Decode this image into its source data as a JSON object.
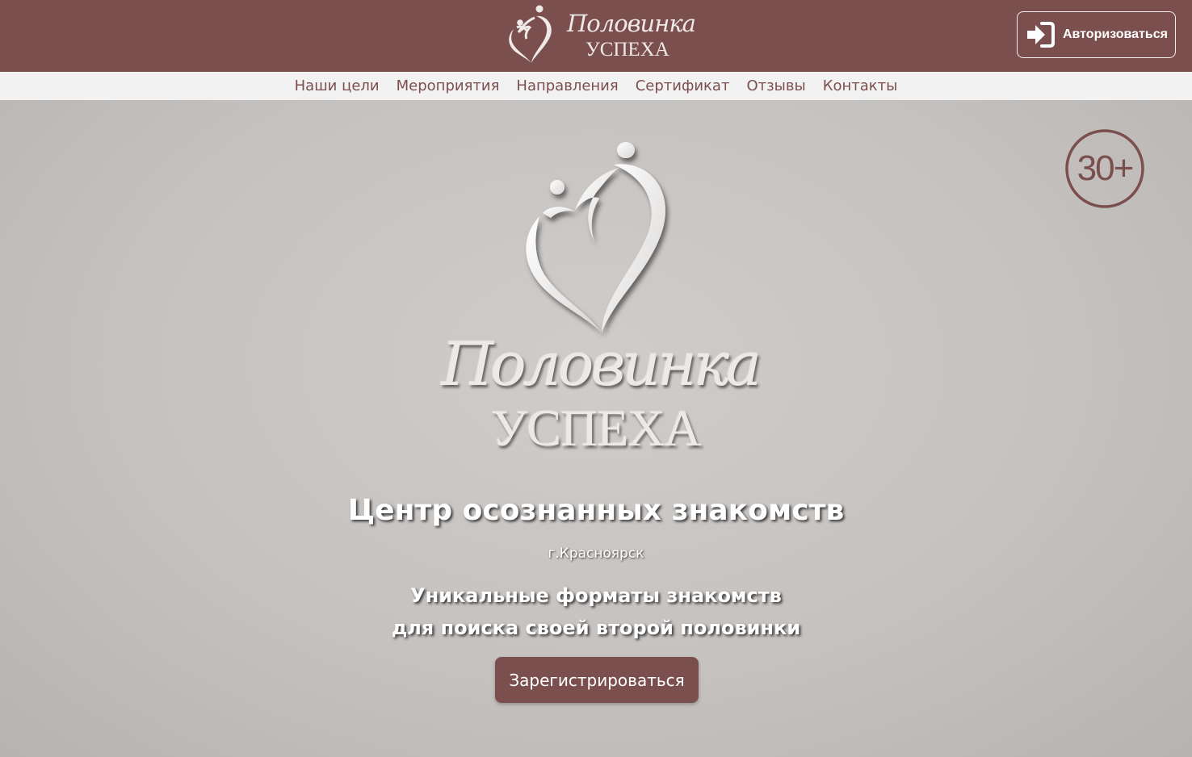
{
  "brand": {
    "script_name": "Половинка",
    "caps_name": "УСПЕХА"
  },
  "header": {
    "login_label": "Авторизоваться",
    "login_icon": "sign-in-icon"
  },
  "nav": {
    "items": [
      {
        "label": "Наши цели"
      },
      {
        "label": "Мероприятия"
      },
      {
        "label": "Направления"
      },
      {
        "label": "Сертификат"
      },
      {
        "label": "Отзывы"
      },
      {
        "label": "Контакты"
      }
    ]
  },
  "hero": {
    "age_badge": "30+",
    "title": "Центр осознанных знакомств",
    "city": "г.Красноярск",
    "subtitle_line1": "Уникальные форматы знакомств",
    "subtitle_line2": "для поиска своей второй половинки",
    "register_label": "Зарегистрироваться"
  },
  "colors": {
    "brand": "#7b4f4e",
    "nav_bg": "#f2f2f2",
    "hero_bg": "#c4c1bf"
  }
}
